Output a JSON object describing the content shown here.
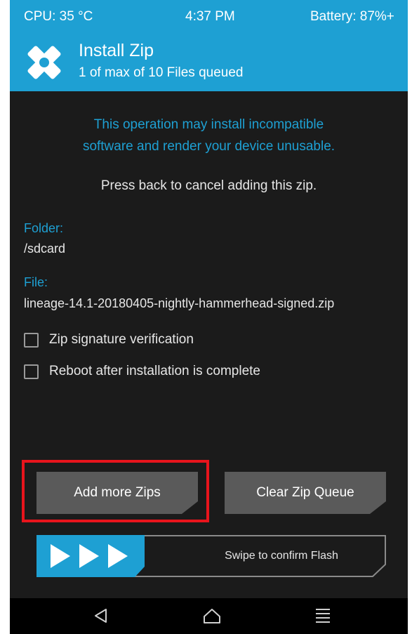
{
  "status_bar": {
    "cpu": "CPU: 35 °C",
    "time": "4:37 PM",
    "battery": "Battery: 87%+"
  },
  "header": {
    "title": "Install Zip",
    "subtitle": "1 of max of 10 Files queued",
    "logo_icon": "twrp-logo-icon"
  },
  "warning": {
    "line1": "This operation may install incompatible",
    "line2": "software and render your device unusable."
  },
  "cancel_hint": "Press back to cancel adding this zip.",
  "folder": {
    "label": "Folder:",
    "value": "/sdcard"
  },
  "file": {
    "label": "File:",
    "value": "lineage-14.1-20180405-nightly-hammerhead-signed.zip"
  },
  "options": [
    {
      "label": "Zip signature verification",
      "checked": false
    },
    {
      "label": "Reboot after installation is complete",
      "checked": false
    }
  ],
  "buttons": {
    "add_more": "Add more Zips",
    "clear_queue": "Clear Zip Queue"
  },
  "swipe": {
    "label": "Swipe to confirm Flash"
  },
  "nav": {
    "back_icon": "back-icon",
    "home_icon": "home-icon",
    "menu_icon": "menu-icon"
  },
  "colors": {
    "accent": "#1ea0d3",
    "background": "#1b1b1b",
    "button": "#5a5a5a",
    "highlight": "#e8141c"
  }
}
